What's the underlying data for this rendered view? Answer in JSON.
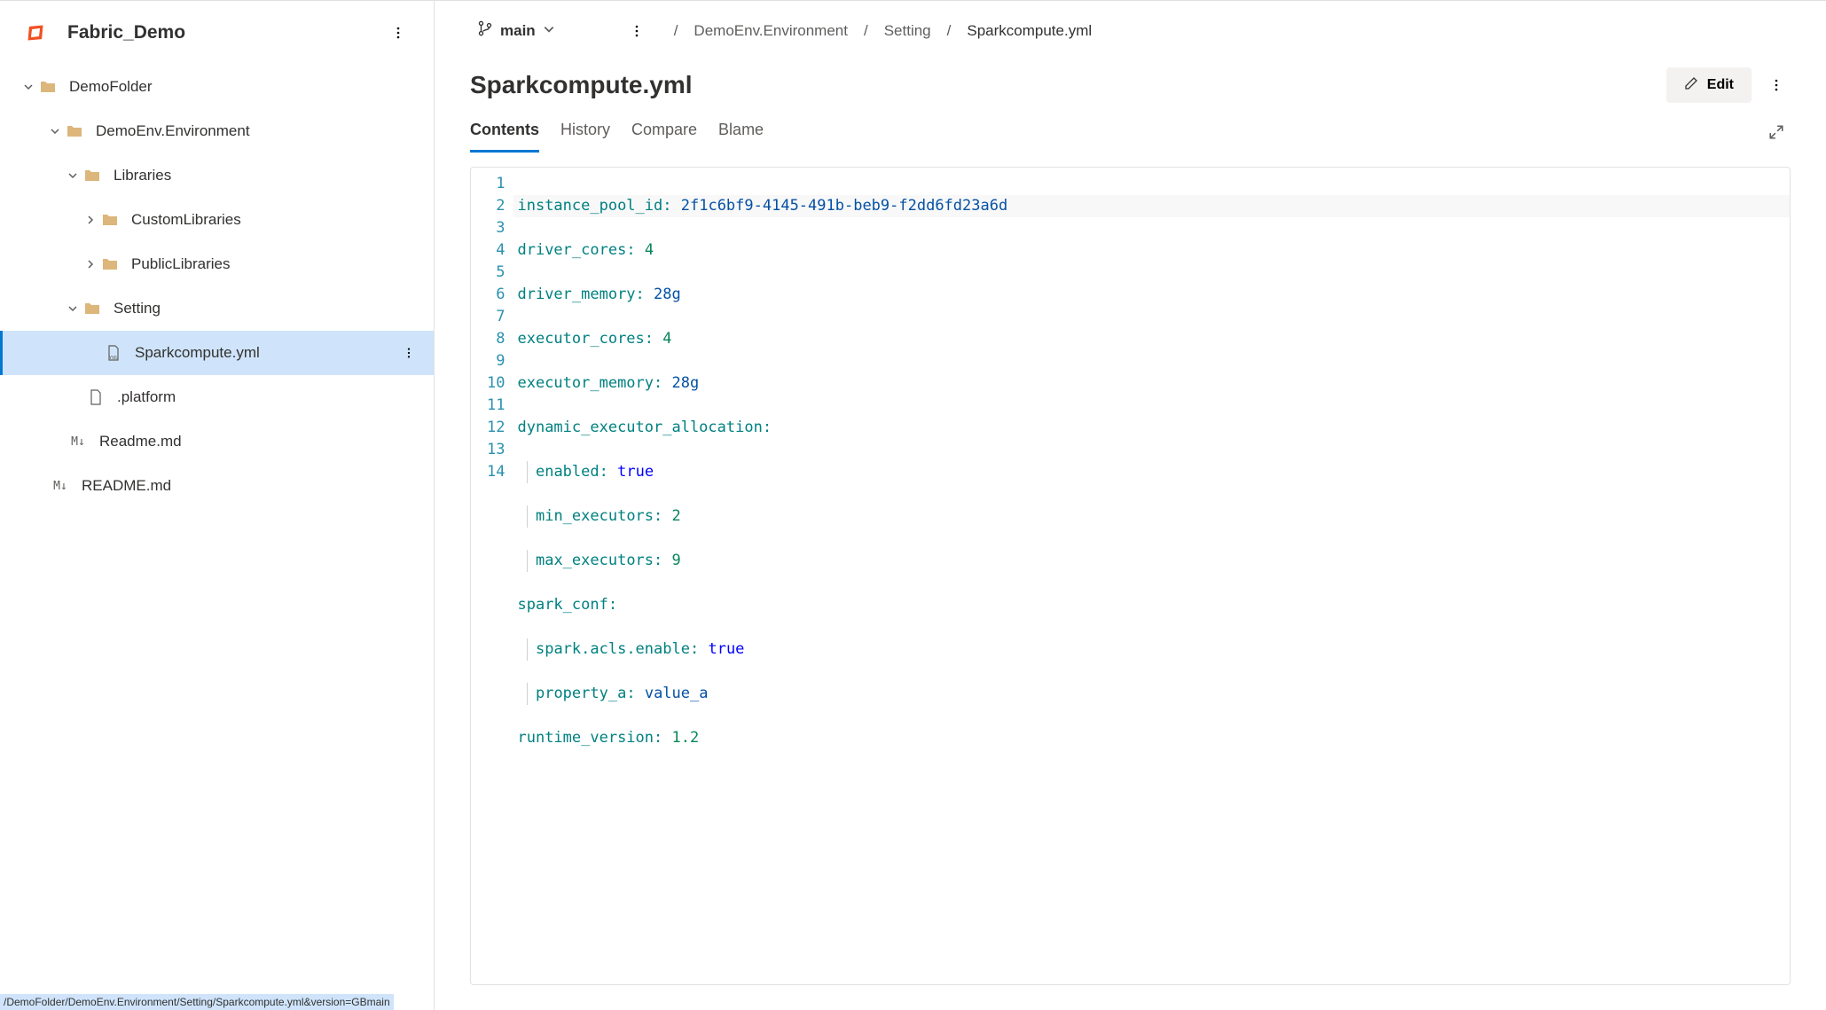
{
  "repo": {
    "name": "Fabric_Demo"
  },
  "branch": {
    "name": "main"
  },
  "breadcrumbs": [
    "DemoEnv.Environment",
    "Setting",
    "Sparkcompute.yml"
  ],
  "file": {
    "title": "Sparkcompute.yml"
  },
  "actions": {
    "edit": "Edit"
  },
  "tabs": {
    "contents": "Contents",
    "history": "History",
    "compare": "Compare",
    "blame": "Blame"
  },
  "tree": {
    "root": "DemoFolder",
    "env": "DemoEnv.Environment",
    "libraries": "Libraries",
    "custom": "CustomLibraries",
    "public": "PublicLibraries",
    "setting": "Setting",
    "spark": "Sparkcompute.yml",
    "platform": ".platform",
    "readme1": "Readme.md",
    "readme2": "README.md"
  },
  "statusbar": "/DemoFolder/DemoEnv.Environment/Setting/Sparkcompute.yml&version=GBmain",
  "code": {
    "instance_pool_id": "2f1c6bf9-4145-491b-beb9-f2dd6fd23a6d",
    "driver_cores": 4,
    "driver_memory": "28g",
    "executor_cores": 4,
    "executor_memory": "28g",
    "dynamic_alloc": {
      "enabled": true,
      "min_executors": 2,
      "max_executors": 9
    },
    "spark_conf": {
      "acls_enable": true,
      "property_a": "value_a"
    },
    "runtime_version": "1.2"
  },
  "tokens": {
    "instance_pool_id": "instance_pool_id",
    "driver_cores": "driver_cores",
    "driver_memory": "driver_memory",
    "executor_cores": "executor_cores",
    "executor_memory": "executor_memory",
    "dynamic": "dynamic_executor_allocation",
    "enabled": "enabled",
    "min_exec": "min_executors",
    "max_exec": "max_executors",
    "spark_conf": "spark_conf",
    "acls": "spark.acls.enable",
    "prop_a": "property_a",
    "runtime": "runtime_version"
  }
}
